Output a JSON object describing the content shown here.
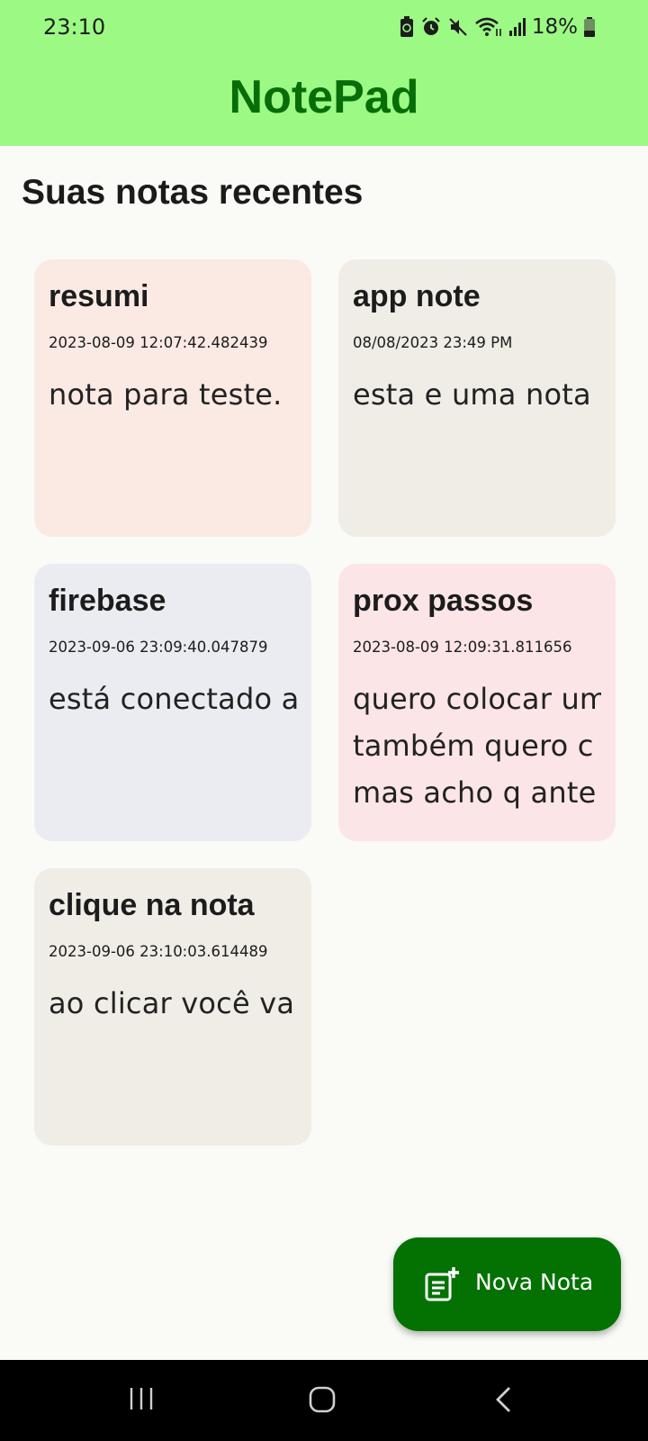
{
  "status_bar": {
    "time": "23:10",
    "battery": "18%",
    "icons": [
      "battery-saver-icon",
      "alarm-icon",
      "mute-icon",
      "wifi-icon",
      "signal-icon",
      "battery-icon"
    ]
  },
  "app_bar": {
    "title": "NotePad"
  },
  "section": {
    "title": "Suas notas recentes"
  },
  "notes": [
    {
      "title": "resumi",
      "date": "2023-08-09 12:07:42.482439",
      "body": "nota para teste.",
      "color": "#fbe9e4"
    },
    {
      "title": "app note",
      "date": "08/08/2023 23:49 PM",
      "body": "esta e uma nota",
      "color": "#f0ede6"
    },
    {
      "title": "firebase",
      "date": "2023-09-06 23:09:40.047879",
      "body": "está conectado ao",
      "color": "#ebecf1"
    },
    {
      "title": "prox passos",
      "date": "2023-08-09 12:09:31.811656",
      "body": "quero colocar um\ntambém quero c\nmas acho q ante",
      "color": "#fce5e6"
    },
    {
      "title": "clique na nota",
      "date": "2023-09-06 23:10:03.614489",
      "body": "ao clicar você vai",
      "color": "#f0ede6"
    }
  ],
  "fab": {
    "label": "Nova Nota",
    "icon": "note-add-icon",
    "color": "#037203"
  },
  "nav_bar": {
    "icons": [
      "recent-apps-icon",
      "home-icon",
      "back-icon"
    ]
  }
}
